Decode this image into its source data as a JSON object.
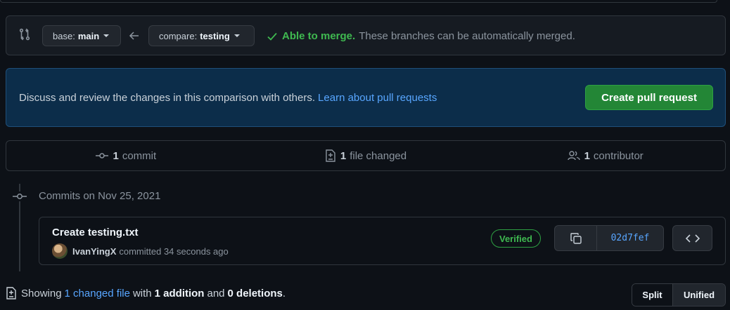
{
  "compare": {
    "base_label": "base:",
    "base_branch": "main",
    "compare_label": "compare:",
    "compare_branch": "testing",
    "merge_status": "Able to merge.",
    "merge_message": "These branches can be automatically merged.",
    "icons": {
      "compare": "git-compare-icon",
      "arrow": "arrow-left-icon",
      "check": "check-icon"
    }
  },
  "blankslate": {
    "text": "Discuss and review the changes in this comparison with others.",
    "link": "Learn about pull requests",
    "button": "Create pull request"
  },
  "summary": {
    "commits_count": "1",
    "commits_label": "commit",
    "files_count": "1",
    "files_label": "file changed",
    "contributors_count": "1",
    "contributors_label": "contributor"
  },
  "timeline": {
    "heading": "Commits on Nov 25, 2021",
    "commit": {
      "title": "Create testing.txt",
      "author": "IvanYingX",
      "meta": "committed 34 seconds ago",
      "verified": "Verified",
      "sha": "02d7fef"
    }
  },
  "toc": {
    "showing": "Showing",
    "changed_link": "1 changed file",
    "with": "with",
    "additions": "1 addition",
    "and": "and",
    "deletions": "0 deletions",
    "period": "."
  },
  "view_toggle": {
    "split": "Split",
    "unified": "Unified"
  },
  "colors": {
    "background": "#0d1117",
    "success": "#3fb950",
    "accent": "#58a6ff",
    "primary_button": "#238636",
    "banner": "#0c2d4a"
  }
}
